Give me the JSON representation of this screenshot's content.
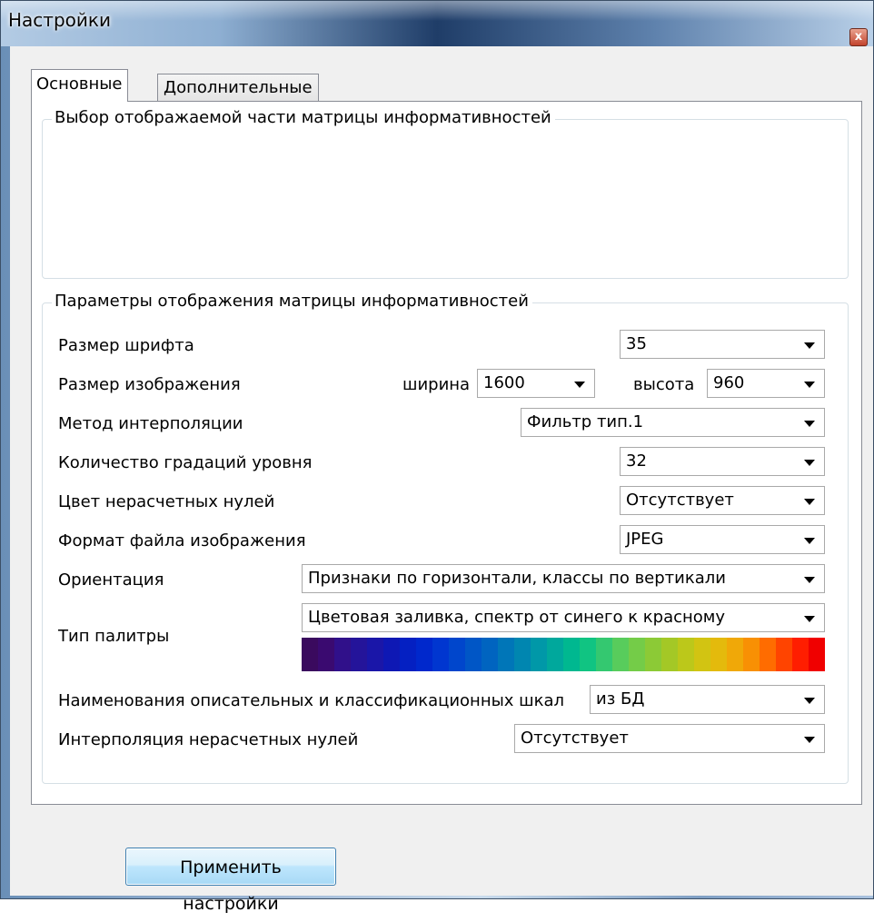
{
  "window": {
    "title": "Настройки",
    "close_symbol": "x"
  },
  "tabs": [
    {
      "label": "Основные",
      "active": true
    },
    {
      "label": "Дополнительные",
      "active": false
    }
  ],
  "group_selection": {
    "title": "Выбор отображаемой части матрицы информативностей"
  },
  "group_params": {
    "title": "Параметры отображения матрицы информативностей",
    "font_size": {
      "label": "Размер шрифта",
      "value": "35"
    },
    "image_size": {
      "label": "Размер изображения",
      "width_label": "ширина",
      "width_value": "1600",
      "height_label": "высота",
      "height_value": "960"
    },
    "interpolation_method": {
      "label": "Метод интерполяции",
      "value": "Фильтр тип.1"
    },
    "gradations": {
      "label": "Количество градаций уровня",
      "value": "32"
    },
    "zero_color": {
      "label": "Цвет нерасчетных нулей",
      "value": "Отсутствует"
    },
    "file_format": {
      "label": "Формат файла изображения",
      "value": "JPEG"
    },
    "orientation": {
      "label": "Ориентация",
      "value": "Признаки по горизонтали, классы по вертикали"
    },
    "palette": {
      "label": "Тип палитры",
      "value": "Цветовая заливка, спектр от синего к красному",
      "colors": [
        "#3a0a5e",
        "#3a0a70",
        "#30108a",
        "#24149a",
        "#1a16a8",
        "#0e18b4",
        "#0420c2",
        "#0028cc",
        "#0036d0",
        "#0046cc",
        "#0056c6",
        "#0064c0",
        "#0076b8",
        "#0086b0",
        "#0098a8",
        "#00a89c",
        "#00b890",
        "#10c482",
        "#34c870",
        "#58cc5c",
        "#74cc48",
        "#8cca36",
        "#a4c826",
        "#bcc81a",
        "#d2c412",
        "#e4ba0c",
        "#f0a808",
        "#f89004",
        "#ff6c00",
        "#ff4400",
        "#ff1e00",
        "#f00000"
      ]
    },
    "scale_names": {
      "label": "Наименования описательных и классификационных шкал",
      "value": "из БД"
    },
    "zero_interpolation": {
      "label": "Интерполяция нерасчетных нулей",
      "value": "Отсутствует"
    }
  },
  "apply_button": {
    "label": "Применить настройки"
  }
}
